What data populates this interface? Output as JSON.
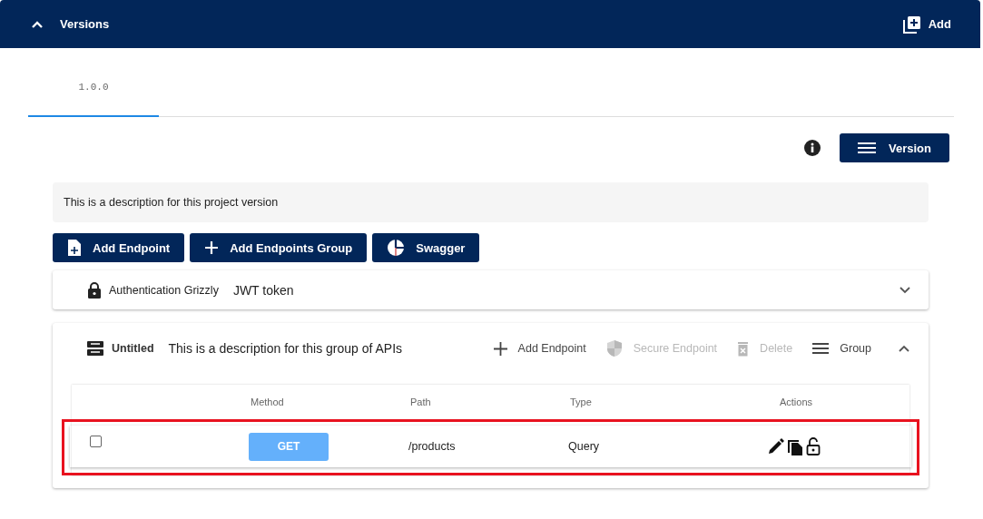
{
  "header": {
    "title": "Versions",
    "expanded": true,
    "add_label": "Add"
  },
  "tabs": [
    {
      "label": "1.0.0",
      "selected": true
    }
  ],
  "version_button": "Version",
  "description": "This is a description for this project version",
  "buttons": [
    {
      "kind": "file",
      "label": "Add Endpoint"
    },
    {
      "kind": "plus",
      "label": "Add Endpoints Group"
    },
    {
      "kind": "swagger",
      "label": "Swagger"
    }
  ],
  "auth": {
    "name": "Authentication Grizzly",
    "type": "JWT token",
    "expanded": false
  },
  "group": {
    "name": "Untitled",
    "description": "This is a description for this group of APIs",
    "expanded": true,
    "actions": [
      {
        "kind": "plus",
        "label": "Add Endpoint",
        "disabled": false
      },
      {
        "kind": "shield",
        "label": "Secure Endpoint",
        "disabled": true
      },
      {
        "kind": "trash",
        "label": "Delete",
        "disabled": true
      },
      {
        "kind": "menu",
        "label": "Group",
        "disabled": false
      }
    ],
    "table": {
      "columns": [
        "Method",
        "Path",
        "Type",
        "Actions"
      ],
      "rows": [
        {
          "checked": false,
          "method": "GET",
          "path": "/products",
          "type": "Query",
          "highlighted": true
        }
      ]
    }
  }
}
